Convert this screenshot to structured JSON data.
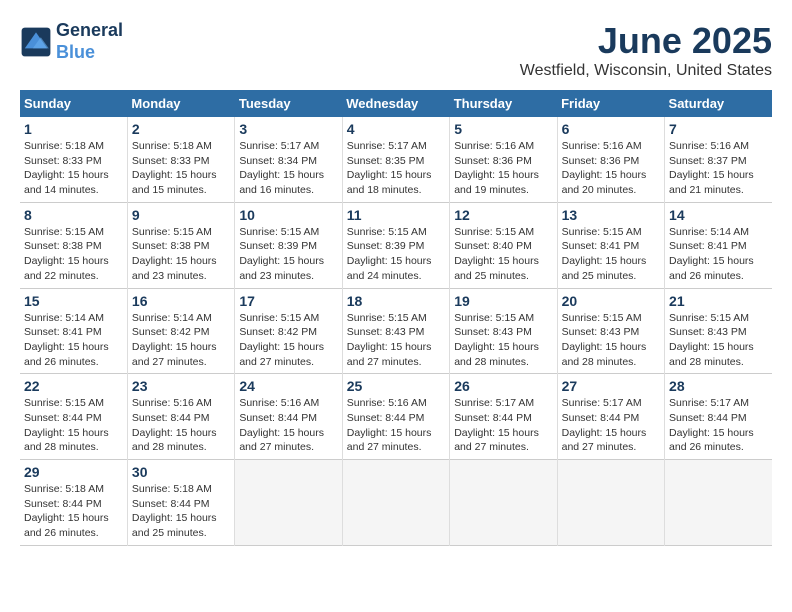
{
  "logo": {
    "line1": "General",
    "line2": "Blue"
  },
  "title": "June 2025",
  "location": "Westfield, Wisconsin, United States",
  "days_of_week": [
    "Sunday",
    "Monday",
    "Tuesday",
    "Wednesday",
    "Thursday",
    "Friday",
    "Saturday"
  ],
  "weeks": [
    [
      {
        "day": "1",
        "sunrise": "5:18 AM",
        "sunset": "8:33 PM",
        "daylight": "15 hours and 14 minutes."
      },
      {
        "day": "2",
        "sunrise": "5:18 AM",
        "sunset": "8:33 PM",
        "daylight": "15 hours and 15 minutes."
      },
      {
        "day": "3",
        "sunrise": "5:17 AM",
        "sunset": "8:34 PM",
        "daylight": "15 hours and 16 minutes."
      },
      {
        "day": "4",
        "sunrise": "5:17 AM",
        "sunset": "8:35 PM",
        "daylight": "15 hours and 18 minutes."
      },
      {
        "day": "5",
        "sunrise": "5:16 AM",
        "sunset": "8:36 PM",
        "daylight": "15 hours and 19 minutes."
      },
      {
        "day": "6",
        "sunrise": "5:16 AM",
        "sunset": "8:36 PM",
        "daylight": "15 hours and 20 minutes."
      },
      {
        "day": "7",
        "sunrise": "5:16 AM",
        "sunset": "8:37 PM",
        "daylight": "15 hours and 21 minutes."
      }
    ],
    [
      {
        "day": "8",
        "sunrise": "5:15 AM",
        "sunset": "8:38 PM",
        "daylight": "15 hours and 22 minutes."
      },
      {
        "day": "9",
        "sunrise": "5:15 AM",
        "sunset": "8:38 PM",
        "daylight": "15 hours and 23 minutes."
      },
      {
        "day": "10",
        "sunrise": "5:15 AM",
        "sunset": "8:39 PM",
        "daylight": "15 hours and 23 minutes."
      },
      {
        "day": "11",
        "sunrise": "5:15 AM",
        "sunset": "8:39 PM",
        "daylight": "15 hours and 24 minutes."
      },
      {
        "day": "12",
        "sunrise": "5:15 AM",
        "sunset": "8:40 PM",
        "daylight": "15 hours and 25 minutes."
      },
      {
        "day": "13",
        "sunrise": "5:15 AM",
        "sunset": "8:41 PM",
        "daylight": "15 hours and 25 minutes."
      },
      {
        "day": "14",
        "sunrise": "5:14 AM",
        "sunset": "8:41 PM",
        "daylight": "15 hours and 26 minutes."
      }
    ],
    [
      {
        "day": "15",
        "sunrise": "5:14 AM",
        "sunset": "8:41 PM",
        "daylight": "15 hours and 26 minutes."
      },
      {
        "day": "16",
        "sunrise": "5:14 AM",
        "sunset": "8:42 PM",
        "daylight": "15 hours and 27 minutes."
      },
      {
        "day": "17",
        "sunrise": "5:15 AM",
        "sunset": "8:42 PM",
        "daylight": "15 hours and 27 minutes."
      },
      {
        "day": "18",
        "sunrise": "5:15 AM",
        "sunset": "8:43 PM",
        "daylight": "15 hours and 27 minutes."
      },
      {
        "day": "19",
        "sunrise": "5:15 AM",
        "sunset": "8:43 PM",
        "daylight": "15 hours and 28 minutes."
      },
      {
        "day": "20",
        "sunrise": "5:15 AM",
        "sunset": "8:43 PM",
        "daylight": "15 hours and 28 minutes."
      },
      {
        "day": "21",
        "sunrise": "5:15 AM",
        "sunset": "8:43 PM",
        "daylight": "15 hours and 28 minutes."
      }
    ],
    [
      {
        "day": "22",
        "sunrise": "5:15 AM",
        "sunset": "8:44 PM",
        "daylight": "15 hours and 28 minutes."
      },
      {
        "day": "23",
        "sunrise": "5:16 AM",
        "sunset": "8:44 PM",
        "daylight": "15 hours and 28 minutes."
      },
      {
        "day": "24",
        "sunrise": "5:16 AM",
        "sunset": "8:44 PM",
        "daylight": "15 hours and 27 minutes."
      },
      {
        "day": "25",
        "sunrise": "5:16 AM",
        "sunset": "8:44 PM",
        "daylight": "15 hours and 27 minutes."
      },
      {
        "day": "26",
        "sunrise": "5:17 AM",
        "sunset": "8:44 PM",
        "daylight": "15 hours and 27 minutes."
      },
      {
        "day": "27",
        "sunrise": "5:17 AM",
        "sunset": "8:44 PM",
        "daylight": "15 hours and 27 minutes."
      },
      {
        "day": "28",
        "sunrise": "5:17 AM",
        "sunset": "8:44 PM",
        "daylight": "15 hours and 26 minutes."
      }
    ],
    [
      {
        "day": "29",
        "sunrise": "5:18 AM",
        "sunset": "8:44 PM",
        "daylight": "15 hours and 26 minutes."
      },
      {
        "day": "30",
        "sunrise": "5:18 AM",
        "sunset": "8:44 PM",
        "daylight": "15 hours and 25 minutes."
      },
      null,
      null,
      null,
      null,
      null
    ]
  ]
}
